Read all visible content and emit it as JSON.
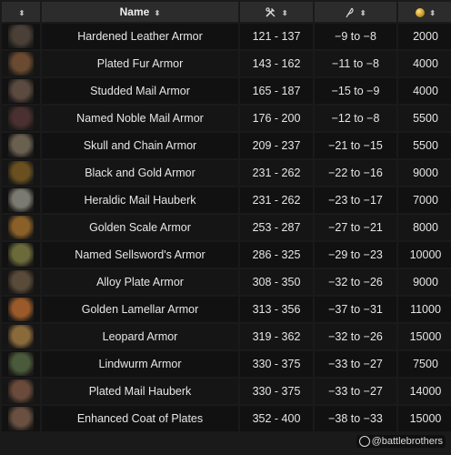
{
  "header": {
    "sort_symbol": "⬍",
    "name_label": "Name",
    "sort_glyph": "⬍",
    "durability_icon": "hammer-wrench-icon",
    "fatigue_icon": "feather-icon",
    "price_icon": "coin-icon"
  },
  "rows": [
    {
      "name": "Hardened Leather Armor",
      "durability": "121 - 137",
      "fatigue": "−9 to −8",
      "price": "2000",
      "thumb_color": "#4a4038"
    },
    {
      "name": "Plated Fur Armor",
      "durability": "143 - 162",
      "fatigue": "−11 to −8",
      "price": "4000",
      "thumb_color": "#6a4a30"
    },
    {
      "name": "Studded Mail Armor",
      "durability": "165 - 187",
      "fatigue": "−15 to −9",
      "price": "4000",
      "thumb_color": "#5a4a40"
    },
    {
      "name": "Named Noble Mail Armor",
      "durability": "176 - 200",
      "fatigue": "−12 to −8",
      "price": "5500",
      "thumb_color": "#4a3030"
    },
    {
      "name": "Skull and Chain Armor",
      "durability": "209 - 237",
      "fatigue": "−21 to −15",
      "price": "5500",
      "thumb_color": "#6a6050"
    },
    {
      "name": "Black and Gold Armor",
      "durability": "231 - 262",
      "fatigue": "−22 to −16",
      "price": "9000",
      "thumb_color": "#6a5020"
    },
    {
      "name": "Heraldic Mail Hauberk",
      "durability": "231 - 262",
      "fatigue": "−23 to −17",
      "price": "7000",
      "thumb_color": "#7a7a70"
    },
    {
      "name": "Golden Scale Armor",
      "durability": "253 - 287",
      "fatigue": "−27 to −21",
      "price": "8000",
      "thumb_color": "#8a6028"
    },
    {
      "name": "Named Sellsword's Armor",
      "durability": "286 - 325",
      "fatigue": "−29 to −23",
      "price": "10000",
      "thumb_color": "#6a6a3a"
    },
    {
      "name": "Alloy Plate Armor",
      "durability": "308 - 350",
      "fatigue": "−32 to −26",
      "price": "9000",
      "thumb_color": "#5a4a3a"
    },
    {
      "name": "Golden Lamellar Armor",
      "durability": "313 - 356",
      "fatigue": "−37 to −31",
      "price": "11000",
      "thumb_color": "#9a5a2a"
    },
    {
      "name": "Leopard Armor",
      "durability": "319 - 362",
      "fatigue": "−32 to −26",
      "price": "15000",
      "thumb_color": "#8a6a3a"
    },
    {
      "name": "Lindwurm Armor",
      "durability": "330 - 375",
      "fatigue": "−33 to −27",
      "price": "7500",
      "thumb_color": "#4a5a3a"
    },
    {
      "name": "Plated Mail Hauberk",
      "durability": "330 - 375",
      "fatigue": "−33 to −27",
      "price": "14000",
      "thumb_color": "#6a4a3a"
    },
    {
      "name": "Enhanced Coat of Plates",
      "durability": "352 - 400",
      "fatigue": "−38 to −33",
      "price": "15000",
      "thumb_color": "#6a5040"
    }
  ],
  "watermark": {
    "text": "@battlebrothers"
  }
}
